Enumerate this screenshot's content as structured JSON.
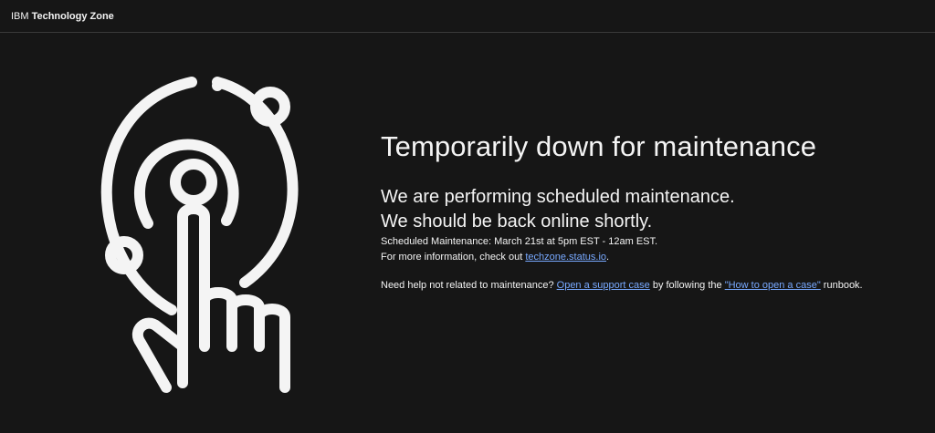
{
  "header": {
    "brand_prefix": "IBM",
    "brand_name": "Technology Zone"
  },
  "main": {
    "headline": "Temporarily down for maintenance",
    "subline_1": "We are performing scheduled maintenance.",
    "subline_2": "We should be back online shortly.",
    "schedule": "Scheduled Maintenance: March 21st at 5pm EST - 12am EST.",
    "info_prefix": "For more information, check out ",
    "info_link": "techzone.status.io",
    "info_suffix": ".",
    "help_prefix": "Need help not related to maintenance? ",
    "help_link_1": "Open a support case",
    "help_middle": " by following the ",
    "help_link_2": "\"How to open a case\"",
    "help_suffix": " runbook."
  },
  "illustration": {
    "icon": "touch-interaction-icon"
  },
  "colors": {
    "background": "#161616",
    "text": "#f4f4f4",
    "link": "#78a9ff",
    "divider": "#393939"
  }
}
